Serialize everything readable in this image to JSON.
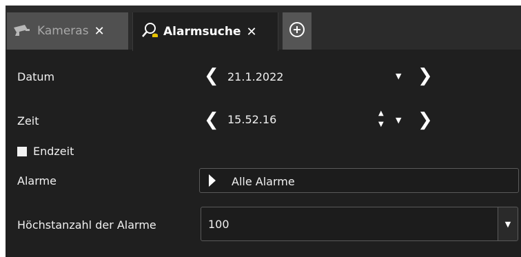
{
  "tabs": {
    "kameras": {
      "label": "Kameras",
      "close": "✕"
    },
    "alarmsuche": {
      "label": "Alarmsuche",
      "close": "✕"
    },
    "add": {
      "symbol": "⊕"
    }
  },
  "form": {
    "datum": {
      "label": "Datum",
      "value": "21.1.2022"
    },
    "zeit": {
      "label": "Zeit",
      "value": "15.52.16"
    },
    "endzeit": {
      "label": "Endzeit",
      "checked": false
    },
    "alarme": {
      "label": "Alarme",
      "value": "Alle Alarme"
    },
    "hoechstanzahl": {
      "label": "Höchstanzahl der Alarme",
      "value": "100"
    }
  },
  "glyphs": {
    "prev": "❮",
    "next": "❯",
    "dropdown": "▼",
    "spin_up": "▲",
    "spin_down": "▼"
  },
  "colors": {
    "background": "#1f1f1f",
    "tabbar": "#2b2b2b",
    "inactive_tab": "#505050",
    "text": "#f0f0f0",
    "alarm_icon_accent": "#e6c200"
  }
}
